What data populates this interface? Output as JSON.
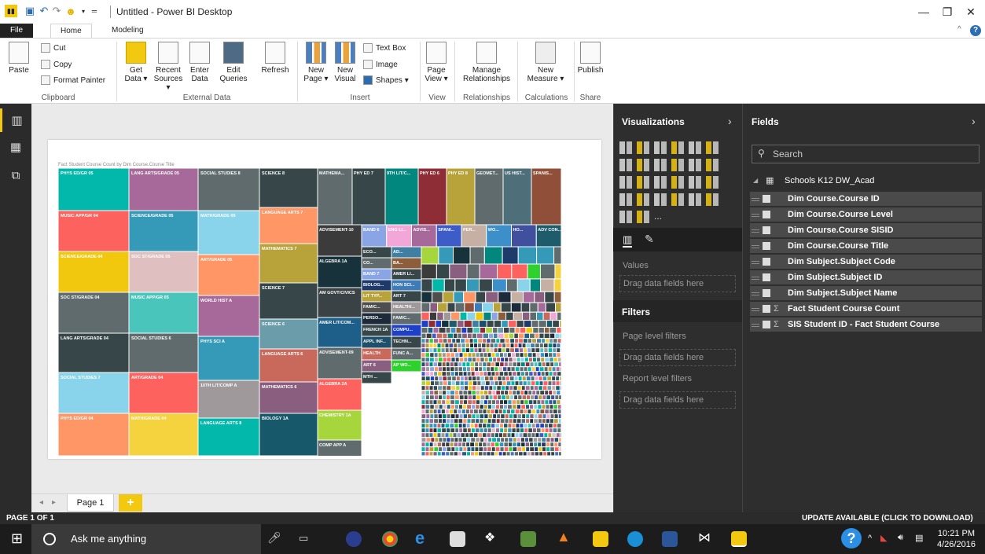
{
  "window": {
    "title": "Untitled - Power BI Desktop",
    "minimize": "—",
    "restore": "❐",
    "close": "✕"
  },
  "tabs": [
    {
      "label": "File"
    },
    {
      "label": "Home"
    },
    {
      "label": "Modeling"
    }
  ],
  "ribbon": {
    "clipboard": {
      "paste": "Paste",
      "cut": "Cut",
      "copy": "Copy",
      "format_painter": "Format Painter",
      "label": "Clipboard"
    },
    "external": {
      "get_data": "Get Data ▾",
      "recent": "Recent Sources ▾",
      "enter": "Enter Data",
      "edit": "Edit Queries",
      "refresh": "Refresh",
      "label": "External Data"
    },
    "insert": {
      "new_page": "New Page ▾",
      "new_visual": "New Visual",
      "text_box": "Text Box",
      "image": "Image",
      "shapes": "Shapes ▾",
      "label": "Insert"
    },
    "view": {
      "page_view": "Page View ▾",
      "label": "View"
    },
    "relationships": {
      "manage": "Manage Relationships",
      "label": "Relationships"
    },
    "calculations": {
      "new_measure": "New Measure ▾",
      "label": "Calculations"
    },
    "share": {
      "publish": "Publish",
      "label": "Share"
    }
  },
  "chart_title": "Fact Student Course Count by Dim Course.Course Title",
  "chart_data": {
    "type": "treemap",
    "title": "Fact Student Course Count by Dim Course.Course Title",
    "labeled_tiles": [
      {
        "label": "PHYS ED/GR 05",
        "color": "#01B8AA"
      },
      {
        "label": "LANG ARTS/GRADE 05",
        "color": "#A66999"
      },
      {
        "label": "SOCIAL STUDIES 8",
        "color": "#5F6B6D"
      },
      {
        "label": "SCIENCE 8",
        "color": "#374649"
      },
      {
        "label": "MUSIC APP/GR 04",
        "color": "#FD625E"
      },
      {
        "label": "SCIENCE/GRADE 05",
        "color": "#3599B8"
      },
      {
        "label": "MATH/GRADE 05",
        "color": "#8AD4EB"
      },
      {
        "label": "LANGUAGE ARTS 7",
        "color": "#FE9666"
      },
      {
        "label": "SCIENCE/GRADE 04",
        "color": "#F2C80F"
      },
      {
        "label": "SOC ST/GRADE 05",
        "color": "#DFBFBF"
      },
      {
        "label": "ART/GRADE 05",
        "color": "#FE9666"
      },
      {
        "label": "MATHEMATICS 7",
        "color": "#B8A23A"
      },
      {
        "label": "SOC ST/GRADE 04",
        "color": "#5F6B6D"
      },
      {
        "label": "MUSIC APP/GR 05",
        "color": "#4AC5BB"
      },
      {
        "label": "WORLD HIST A",
        "color": "#A66999"
      },
      {
        "label": "SCIENCE 7",
        "color": "#374649"
      },
      {
        "label": "LANG ARTS/GRADE 04",
        "color": "#374649"
      },
      {
        "label": "SOCIAL STUDIES 6",
        "color": "#5F6B6D"
      },
      {
        "label": "PHYS SCI A",
        "color": "#3599B8"
      },
      {
        "label": "SCIENCE 6",
        "color": "#6A9CAA"
      },
      {
        "label": "SOCIAL STUDIES 7",
        "color": "#8AD4EB"
      },
      {
        "label": "ART/GRADE 04",
        "color": "#FD625E"
      },
      {
        "label": "10TH LIT/COMP A",
        "color": "#A0999B"
      },
      {
        "label": "LANGUAGE ARTS 6",
        "color": "#C9695C"
      },
      {
        "label": "PHYS ED/GR 04",
        "color": "#FE9666"
      },
      {
        "label": "MATH/GRADE 04",
        "color": "#F5D33F"
      },
      {
        "label": "LANGUAGE ARTS 8",
        "color": "#01B8AA"
      },
      {
        "label": "MATHEMATICS 6",
        "color": "#8A5E7E"
      },
      {
        "label": "BIOLOGY 1A",
        "color": "#17596B"
      },
      {
        "label": "MATHEMA...",
        "color": "#5F6B6D"
      },
      {
        "label": "PHY ED 7",
        "color": "#374649"
      },
      {
        "label": "9TH LIT/C...",
        "color": "#01877D"
      },
      {
        "label": "PHY ED 6",
        "color": "#8E2D36"
      },
      {
        "label": "PHY ED 8",
        "color": "#B8A23A"
      },
      {
        "label": "GEOMET...",
        "color": "#5F6B6D"
      },
      {
        "label": "US HIST...",
        "color": "#4E6F7A"
      },
      {
        "label": "SPANIS...",
        "color": "#8F4F38"
      },
      {
        "label": "ADVISEMENT-10",
        "color": "#3B3B3B"
      },
      {
        "label": "ALGEBRA 1A",
        "color": "#17323A"
      },
      {
        "label": "AM GOVT/CIVICS",
        "color": "#3B4246"
      },
      {
        "label": "AMER LIT/COM...",
        "color": "#1E5F8A"
      },
      {
        "label": "ADVISEMENT-09",
        "color": "#5F6B6D"
      },
      {
        "label": "ALGEBRA 2A",
        "color": "#FD625E"
      },
      {
        "label": "CHEMISTRY 1A",
        "color": "#A6D63B"
      },
      {
        "label": "COMP APP A",
        "color": "#5F6B6D"
      },
      {
        "label": "BAND 6",
        "color": "#8AA5E6"
      },
      {
        "label": "ENG LI...",
        "color": "#F2A7D8"
      },
      {
        "label": "ADVIS...",
        "color": "#A66999"
      },
      {
        "label": "SPANI...",
        "color": "#3E5CC7"
      },
      {
        "label": "PER...",
        "color": "#C6B0A3"
      },
      {
        "label": "WO...",
        "color": "#3D8FC9"
      },
      {
        "label": "HO...",
        "color": "#404F9E"
      },
      {
        "label": "ADV CON...",
        "color": "#1F5C6B"
      },
      {
        "label": "ECO...",
        "color": "#374649"
      },
      {
        "label": "AD...",
        "color": "#3F7FA1"
      },
      {
        "label": "CO...",
        "color": "#5F6B6D"
      },
      {
        "label": "BA...",
        "color": "#8C5E3C"
      },
      {
        "label": "HON LANG...",
        "color": "#FE9666"
      },
      {
        "label": "BAND 7",
        "color": "#8AA5E6"
      },
      {
        "label": "AMER LI...",
        "color": "#374649"
      },
      {
        "label": "BIOLOG...",
        "color": "#1D3A6B"
      },
      {
        "label": "HON SCI...",
        "color": "#3E7CB8"
      },
      {
        "label": "LIT TYP...",
        "color": "#B8A23A"
      },
      {
        "label": "ART 7",
        "color": "#374649"
      },
      {
        "label": "FAM/C...",
        "color": "#4E4E4E"
      },
      {
        "label": "HEALTH/...",
        "color": "#A0999B"
      },
      {
        "label": "PERSO...",
        "color": "#1E2A3A"
      },
      {
        "label": "FAM/C...",
        "color": "#5F6B6D"
      },
      {
        "label": "FRENCH 1A",
        "color": "#374649"
      },
      {
        "label": "COMPU...",
        "color": "#1E3FC7"
      },
      {
        "label": "APPL INF...",
        "color": "#1E4F6B"
      },
      {
        "label": "TECHN...",
        "color": "#374649"
      },
      {
        "label": "HEALTH",
        "color": "#C9695C"
      },
      {
        "label": "FUNC A...",
        "color": "#5F6B6D"
      },
      {
        "label": "ART 6",
        "color": "#8A5E7E"
      },
      {
        "label": "AP WO...",
        "color": "#2ED12E"
      },
      {
        "label": "MTH ...",
        "color": "#374649"
      }
    ]
  },
  "page_tab": "Page 1",
  "status_left": "PAGE 1 OF 1",
  "status_right": "UPDATE AVAILABLE (CLICK TO DOWNLOAD)",
  "viz": {
    "title": "Visualizations",
    "values_label": "Values",
    "drop_values": "Drag data fields here",
    "filters_title": "Filters",
    "page_filters": "Page level filters",
    "drop_page": "Drag data fields here",
    "report_filters": "Report level filters",
    "drop_report": "Drag data fields here",
    "more": "..."
  },
  "fields": {
    "title": "Fields",
    "search_placeholder": "Search",
    "table": "Schools K12 DW_Acad",
    "items": [
      {
        "label": "Dim Course.Course ID",
        "sigma": ""
      },
      {
        "label": "Dim Course.Course Level",
        "sigma": ""
      },
      {
        "label": "Dim Course.Course SISID",
        "sigma": ""
      },
      {
        "label": "Dim Course.Course Title",
        "sigma": ""
      },
      {
        "label": "Dim Subject.Subject Code",
        "sigma": ""
      },
      {
        "label": "Dim Subject.Subject ID",
        "sigma": ""
      },
      {
        "label": "Dim Subject.Subject Name",
        "sigma": ""
      },
      {
        "label": "Fact Student Course Count",
        "sigma": "Σ"
      },
      {
        "label": "SIS Student ID - Fact Student Course",
        "sigma": "Σ"
      }
    ]
  },
  "taskbar": {
    "search": "Ask me anything",
    "time": "10:21 PM",
    "date": "4/26/2016"
  }
}
